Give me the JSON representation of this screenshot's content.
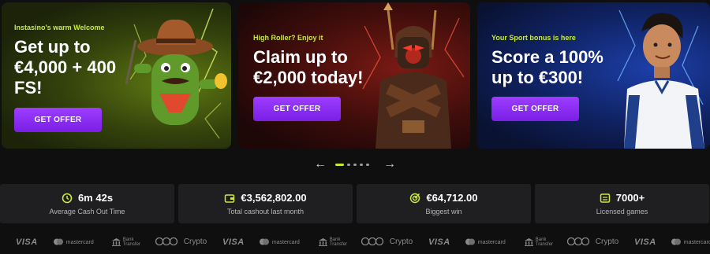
{
  "promos": [
    {
      "eyebrow": "Instasino's warm Welcome",
      "headline": "Get up to\n€4,000 + 400\nFS!",
      "cta": "GET OFFER",
      "art": "cactus-cowboy-illustration"
    },
    {
      "eyebrow": "High Roller? Enjoy it",
      "headline": "Claim up to\n€2,000 today!",
      "cta": "GET OFFER",
      "art": "pharaoh-warrior-illustration"
    },
    {
      "eyebrow": "Your Sport bonus is here",
      "headline": "Score a 100%\nup to €300!",
      "cta": "GET OFFER",
      "art": "soccer-player-illustration"
    }
  ],
  "carousel": {
    "prev": "←",
    "next": "→",
    "pages": 5,
    "active_page": 1
  },
  "stats": [
    {
      "icon": "clock-icon",
      "value": "6m 42s",
      "label": "Average Cash Out Time"
    },
    {
      "icon": "wallet-icon",
      "value": "€3,562,802.00",
      "label": "Total cashout last month"
    },
    {
      "icon": "target-icon",
      "value": "€64,712.00",
      "label": "Biggest win"
    },
    {
      "icon": "slot-machine-icon",
      "value": "7000+",
      "label": "Licensed games"
    }
  ],
  "payments": {
    "visa": "VISA",
    "mastercard": "mastercard",
    "bank_line1": "Bank",
    "bank_line2": "Transfer",
    "crypto": "Crypto"
  },
  "colors": {
    "accent": "#c8e842",
    "button": "#8a2be2",
    "card_bg": "#1f1f21",
    "page_bg": "#0f0f10"
  }
}
